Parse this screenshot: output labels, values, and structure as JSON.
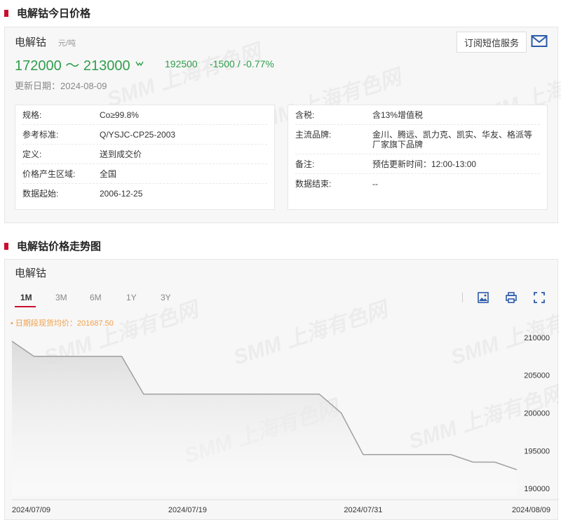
{
  "section1": {
    "title": "电解钴今日价格"
  },
  "section2": {
    "title": "电解钴价格走势图"
  },
  "product": {
    "name": "电解钴",
    "unit": "元/吨",
    "price_range": "172000 ～ 213000",
    "avg_price": "192500",
    "change": "-1500  /  -0.77%",
    "update_date": "更新日期：2024-08-09",
    "subscribe_label": "订阅短信服务"
  },
  "info_left": [
    {
      "key": "规格:",
      "value": "Co≥99.8%"
    },
    {
      "key": "参考标准:",
      "value": "Q/YSJC-CP25-2003"
    },
    {
      "key": "定义:",
      "value": "送到成交价"
    },
    {
      "key": "价格产生区域:",
      "value": "全国"
    },
    {
      "key": "数据起始:",
      "value": "2006-12-25"
    }
  ],
  "info_right": [
    {
      "key": "含税:",
      "value": "含13%增值税"
    },
    {
      "key": "主流品牌:",
      "value": "金川、腾远、凯力克、凯实、华友、格派等厂家旗下品牌"
    },
    {
      "key": "备注:",
      "value": "预估更新时间：12:00-13:00"
    },
    {
      "key": "数据结束:",
      "value": "--"
    }
  ],
  "chart": {
    "name": "电解钴",
    "tabs": [
      "1M",
      "3M",
      "6M",
      "1Y",
      "3Y"
    ],
    "active_tab": "1M",
    "avg_note": "• 日期段现货均价：201687.50",
    "watermark": "SMM 上海有色网"
  },
  "colors": {
    "accent": "#c8102e",
    "price_down": "#2f9e4b",
    "note": "#f0a04b",
    "line": "#a0a0a0"
  },
  "chart_data": {
    "type": "area",
    "x_tick_labels": [
      "2024/07/09",
      "2024/07/19",
      "2024/07/31",
      "2024/08/09"
    ],
    "x": [
      "2024/07/09",
      "2024/07/10",
      "2024/07/11",
      "2024/07/12",
      "2024/07/15",
      "2024/07/16",
      "2024/07/17",
      "2024/07/18",
      "2024/07/19",
      "2024/07/22",
      "2024/07/23",
      "2024/07/24",
      "2024/07/25",
      "2024/07/26",
      "2024/07/29",
      "2024/07/30",
      "2024/07/31",
      "2024/08/01",
      "2024/08/02",
      "2024/08/05",
      "2024/08/06",
      "2024/08/07",
      "2024/08/08",
      "2024/08/09"
    ],
    "values": [
      209500,
      207500,
      207500,
      207500,
      207500,
      207500,
      202500,
      202500,
      202500,
      202500,
      202500,
      202500,
      202500,
      202500,
      202500,
      200000,
      194500,
      194500,
      194500,
      194500,
      194500,
      193500,
      193500,
      192500
    ],
    "y_ticks": [
      190000,
      195000,
      200000,
      205000,
      210000
    ],
    "ylim": [
      189000,
      211000
    ],
    "grid": false,
    "y_axis_side": "right"
  }
}
